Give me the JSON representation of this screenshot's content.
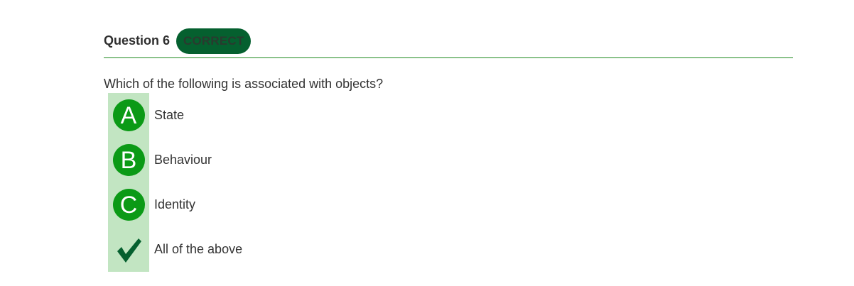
{
  "question": {
    "title": "Question 6",
    "status": "CORRECT",
    "text": "Which of the following is associated with objects?"
  },
  "options": [
    {
      "letter": "A",
      "label": "State"
    },
    {
      "letter": "B",
      "label": "Behaviour"
    },
    {
      "letter": "C",
      "label": "Identity"
    },
    {
      "letter": "",
      "label": "All of the above",
      "icon": "checkmark-icon"
    }
  ],
  "colors": {
    "accent_green": "#0b9a16",
    "badge_green": "#05602f",
    "highlight_green": "#c2e5c2",
    "divider_green": "#1f8a1f"
  }
}
